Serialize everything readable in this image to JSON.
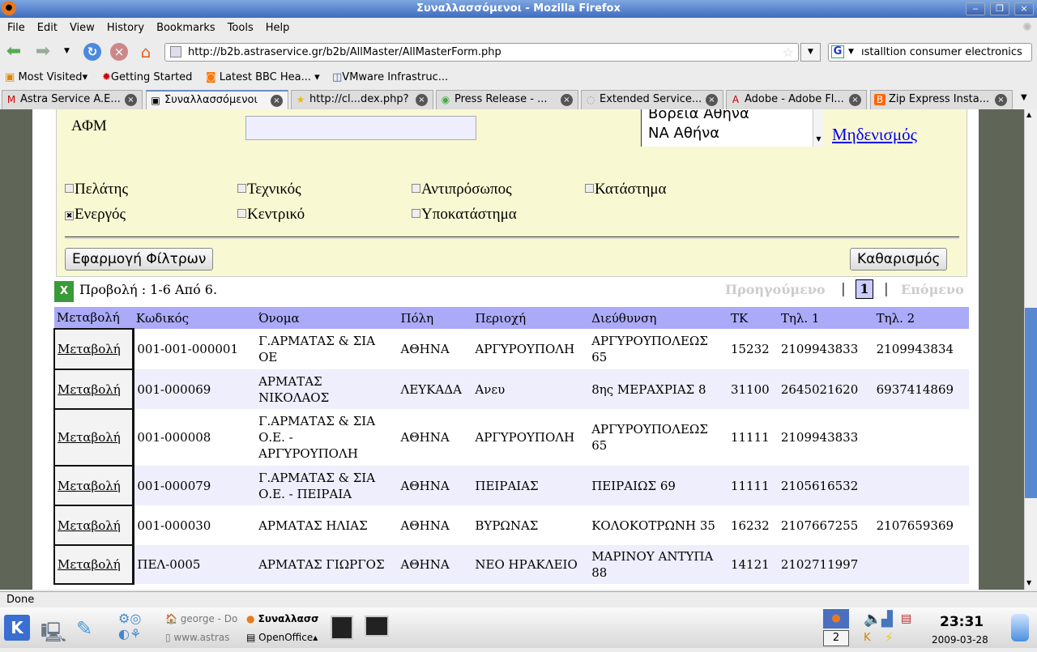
{
  "window": {
    "title": "Συναλλασσόμενοι - Mozilla Firefox",
    "minimize": "‒",
    "maximize": "❐",
    "close": "×"
  },
  "menu": [
    "File",
    "Edit",
    "View",
    "History",
    "Bookmarks",
    "Tools",
    "Help"
  ],
  "nav": {
    "url": "http://b2b.astraservice.gr/b2b/AllMaster/AllMasterForm.php",
    "search": "ıstalltion consumer electronics"
  },
  "bookmarks": [
    "Most Visited",
    "Getting Started",
    "Latest BBC Hea...",
    "VMware Infrastruc..."
  ],
  "tabs": [
    {
      "label": "Astra Service A.E...",
      "active": false
    },
    {
      "label": "Συναλλασσόμενοι",
      "active": true
    },
    {
      "label": "http://cl...dex.php?",
      "active": false
    },
    {
      "label": "Press Release - ...",
      "active": false
    },
    {
      "label": "Extended Service...",
      "active": false
    },
    {
      "label": "Adobe - Adobe Fl...",
      "active": false
    },
    {
      "label": "Zip Express Insta...",
      "active": false
    }
  ],
  "filter": {
    "afm_label": "ΑΦΜ",
    "afm_value": "",
    "region_options": [
      "Βόρεια Αθήνα",
      "ΝΑ Αθήνα"
    ],
    "reset_link": "Μηδενισμός",
    "checkboxes": [
      {
        "label": "Πελάτης",
        "checked": false
      },
      {
        "label": "Τεχνικός",
        "checked": false
      },
      {
        "label": "Αντιπρόσωπος",
        "checked": false
      },
      {
        "label": "Κατάστημα",
        "checked": false
      },
      {
        "label": "Ενεργός",
        "checked": true
      },
      {
        "label": "Κεντρικό",
        "checked": false
      },
      {
        "label": "Υποκατάστημα",
        "checked": false
      }
    ],
    "apply_button": "Εφαρμογή Φίλτρων",
    "clear_button": "Καθαρισμός"
  },
  "results": {
    "summary": "Προβολή : 1-6 Από 6.",
    "prev": "Προηγούμενο",
    "page": "1",
    "next": "Επόμενο",
    "sep": "|"
  },
  "table": {
    "headers": [
      "Μεταβολή",
      "Κωδικός",
      "Όνομα",
      "Πόλη",
      "Περιοχή",
      "Διεύθυνση",
      "ΤΚ",
      "Τηλ. 1",
      "Τηλ. 2"
    ],
    "rows": [
      [
        "Μεταβολή",
        "001-001-000001",
        "Γ.ΑΡΜΑΤΑΣ & ΣΙΑ ΟΕ",
        "ΑΘΗΝΑ",
        "ΑΡΓΥΡΟΥΠΟΛΗ",
        "ΑΡΓΥΡΟΥΠΟΛΕΩΣ 65",
        "15232",
        "2109943833",
        "2109943834"
      ],
      [
        "Μεταβολή",
        "001-000069",
        "ΑΡΜΑΤΑΣ ΝΙΚΟΛΑΟΣ",
        "ΛΕΥΚΑΔΑ",
        "Ανευ",
        "8ης ΜΕΡΑΧΡΙΑΣ 8",
        "31100",
        "2645021620",
        "6937414869"
      ],
      [
        "Μεταβολή",
        "001-000008",
        "Γ.ΑΡΜΑΤΑΣ & ΣΙΑ Ο.Ε. - ΑΡΓΥΡΟΥΠΟΛΗ",
        "ΑΘΗΝΑ",
        "ΑΡΓΥΡΟΥΠΟΛΗ",
        "ΑΡΓΥΡΟΥΠΟΛΕΩΣ 65",
        "11111",
        "2109943833",
        ""
      ],
      [
        "Μεταβολή",
        "001-000079",
        "Γ.ΑΡΜΑΤΑΣ & ΣΙΑ Ο.Ε. - ΠΕΙΡΑΙΑ",
        "ΑΘΗΝΑ",
        "ΠΕΙΡΑΙΑΣ",
        "ΠΕΙΡΑΙΩΣ 69",
        "11111",
        "2105616532",
        ""
      ],
      [
        "Μεταβολή",
        "001-000030",
        "ΑΡΜΑΤΑΣ ΗΛΙΑΣ",
        "ΑΘΗΝΑ",
        "ΒΥΡΩΝΑΣ",
        "ΚΟΛΟΚΟΤΡΩΝΗ 35",
        "16232",
        "2107667255",
        "2107659369"
      ],
      [
        "Μεταβολή",
        "ΠΕΛ-0005",
        "ΑΡΜΑΤΑΣ ΓΙΩΡΓΟΣ",
        "ΑΘΗΝΑ",
        "ΝΕΟ ΗΡΑΚΛΕΙΟ",
        "ΜΑΡΙΝΟΥ ΑΝΤΥΠΑ 88",
        "14121",
        "2102711997",
        ""
      ]
    ]
  },
  "status": "Done",
  "taskbar": {
    "tasks": [
      "george - Do",
      "Συναλλασσ",
      "www.astras",
      "OpenOffice"
    ],
    "desktop": "2",
    "time": "23:31",
    "date": "2009-03-28"
  },
  "colors": {
    "title_bar": "#3e6cc0",
    "filter_bg": "#f8f8d2",
    "table_header": "#aaaaf8",
    "row_alt": "#eeeefc",
    "link": "#0000ee"
  }
}
